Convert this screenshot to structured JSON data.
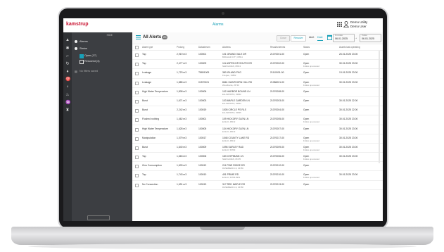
{
  "app": {
    "brand": "kamstrup",
    "title": "Alarms"
  },
  "user": {
    "line1": "Demo Utility",
    "line2": "Demo User"
  },
  "filters": {
    "hide": "HIDE",
    "type_label": "Alarms",
    "status_label": "Status",
    "open_label": "Open (17)",
    "resolved_label": "Resolved (3)",
    "no_saved": "No filters saved"
  },
  "header": {
    "title": "All Alerts",
    "count": "20",
    "close_btn": "Close",
    "resolve_btn": "Resolve",
    "tab_alert": "Alert",
    "tab_date": "Date",
    "from_label": "Fromdate",
    "from_value": "06.01.2025",
    "to_label": "Todate",
    "to_value": "06.01.2025"
  },
  "columns": [
    "Alarm type",
    "Prolong",
    "Datastream",
    "Address",
    "Read/schemes",
    "Status",
    "Assets last operating"
  ],
  "rows": [
    [
      "Tap",
      "2,919 m3",
      "100001",
      "101 GRAND VALE DR",
      "BRIGHAM CITY, 83511",
      "21070001-00",
      "Open",
      "",
      "26.01.2025 23:00"
    ],
    [
      "Tap",
      "2,477 m3",
      "100009",
      "111 ASPEN DR SOUTH DR",
      "NEW HAVEN, 06513",
      "21070002-00",
      "Open",
      "Follow up ensured",
      "30.01.2025 23:00"
    ],
    [
      "Leakage",
      "1,723 m3",
      "T8801009",
      "380 ISLAND PKG",
      "Fireglen, 33852",
      "21110001-00",
      "Open",
      "",
      "13.01.2025 23:00"
    ],
    [
      "Leakage",
      "1,885 m3",
      "01570001",
      "8661 HAWTHORN HILL RD",
      "Woodbucks, 25730",
      "21086001-00",
      "Open",
      "Follow up ensured",
      "30.01.2025 23:00"
    ],
    [
      "High Water Temperature",
      "1,808 m3",
      "100006",
      "102 HARBOR BOUND LN",
      "ELLSWORTH, 03842",
      "21070008-00",
      "Open",
      "",
      ""
    ],
    [
      "Burst",
      "1,671 m3",
      "100003",
      "103 MAPLE GARDEN LN",
      "ELLSWORTH, 03843",
      "21070003-00",
      "Open",
      "",
      "30.01.2025 22:00"
    ],
    [
      "Burst",
      "2,242 m3",
      "100019",
      "1005 CIRCLE PS RLS",
      "ELLSWORTH, 03845",
      "21070004-00",
      "Open",
      "",
      "30.01.2025 22:00"
    ],
    [
      "Flushed nothing",
      "1,462 m3",
      "100001",
      "109 HICKORY GLEN LN",
      "ELSLO, 45012",
      "21070005-00",
      "Open",
      "Follow up ensured",
      "30.01.2025 23:00"
    ],
    [
      "High Water Temperature",
      "1,628 m3",
      "100005",
      "134 HICKORY GLEN LN",
      "ELSLO, 45013",
      "21070007-00",
      "Open",
      "",
      "30.01.2025 23:00"
    ],
    [
      "Manipulation",
      "1,079 m3",
      "100017",
      "1048 COUNTY LAKE RD",
      "ELSLO, 45012",
      "21070017-00",
      "Open",
      "Follow up ensured",
      "30.01.2025 23:00"
    ],
    [
      "Burst",
      "1,640 m3",
      "100009",
      "1096 SURLEY RAD",
      "ELSLO, 50783",
      "21070009-00",
      "Open",
      "Follow up ensured",
      "30.01.2025 23:00"
    ],
    [
      "Tap",
      "1,663 m3",
      "100006",
      "183 CHIPMUNK LN",
      "NEW HAVEN, 06725",
      "21070006-00",
      "Open",
      "Follow up ensured",
      "30.01.2025 23:00"
    ],
    [
      "Zero Consumption",
      "1,609 m3",
      "100012",
      "211 PINE RIDGE DR",
      "RIVERBEND LS, 36786",
      "21070012-00",
      "Open",
      "",
      ""
    ],
    [
      "Tap",
      "1,743 m3",
      "100010",
      "491 PRIME RD",
      "ELSLO, 50786 8951",
      "21070010-00",
      "Open",
      "Follow up ensured",
      "30.01.2025 23:00"
    ],
    [
      "No Connection",
      "1,691 m3",
      "100013",
      "317 RED MAPLE DR",
      "RIVERBEND LS, 36788",
      "21070013-00",
      "Open",
      "",
      ""
    ]
  ],
  "colors": {
    "brand": "#c8102e",
    "accent": "#18a0b8",
    "sidebar": "#2f3134",
    "panel": "#3c3e42"
  }
}
